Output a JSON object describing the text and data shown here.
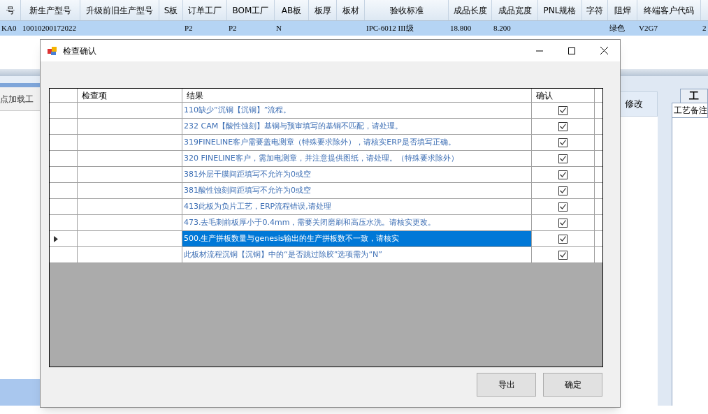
{
  "background": {
    "table": {
      "columns": [
        "号",
        "新生产型号",
        "升级前旧生产型号",
        "S板",
        "订单工厂",
        "BOM工厂",
        "AB板",
        "板厚",
        "板材",
        "验收标准",
        "成品长度",
        "成品宽度",
        "PNL规格",
        "字符",
        "阻焊",
        "终端客户代码"
      ],
      "rows": [
        [
          "KA0",
          "10010200172022",
          "",
          "",
          "P2",
          "P2",
          "N",
          "",
          "",
          "IPC-6012 III级",
          "18.800",
          "8.200",
          "",
          "",
          "绿色",
          "V2G7",
          "2"
        ]
      ]
    },
    "load_button": "点加载工",
    "side_column": "修改",
    "side_tab": "工",
    "side_label": "工艺备注"
  },
  "dialog": {
    "title": "检查确认",
    "columns": [
      "检查项",
      "结果",
      "确认"
    ],
    "rows": [
      {
        "result": "110缺少“沉铜【沉铜】”流程。",
        "confirmed": true,
        "selected": false
      },
      {
        "result": "232 CAM【酸性蚀刻】基铜与预审填写的基铜不匹配，请处理。",
        "confirmed": true,
        "selected": false
      },
      {
        "result": "319FINELINE客户需要盖电测章（特殊要求除外），请核实ERP是否填写正确。",
        "confirmed": true,
        "selected": false
      },
      {
        "result": "320 FINELINE客户，需加电测章，并注意提供图纸，请处理。（特殊要求除外）",
        "confirmed": true,
        "selected": false
      },
      {
        "result": "381外层干膜间距填写不允许为0或空",
        "confirmed": true,
        "selected": false
      },
      {
        "result": "381酸性蚀刻间距填写不允许为0或空",
        "confirmed": true,
        "selected": false
      },
      {
        "result": "413此板为负片工艺，ERP流程错误,请处理",
        "confirmed": true,
        "selected": false
      },
      {
        "result": "473.去毛刺前板厚小于0.4mm，需要关闭磨刷和高压水洗。请核实更改。",
        "confirmed": true,
        "selected": false
      },
      {
        "result": "500.生产拼板数量与genesis输出的生产拼板数不一致，请核实",
        "confirmed": true,
        "selected": true
      },
      {
        "result": "此板材流程沉铜【沉铜】中的“是否跳过除胶”选项需为“N”",
        "confirmed": true,
        "selected": false
      }
    ],
    "buttons": [
      "导出",
      "确定"
    ]
  }
}
